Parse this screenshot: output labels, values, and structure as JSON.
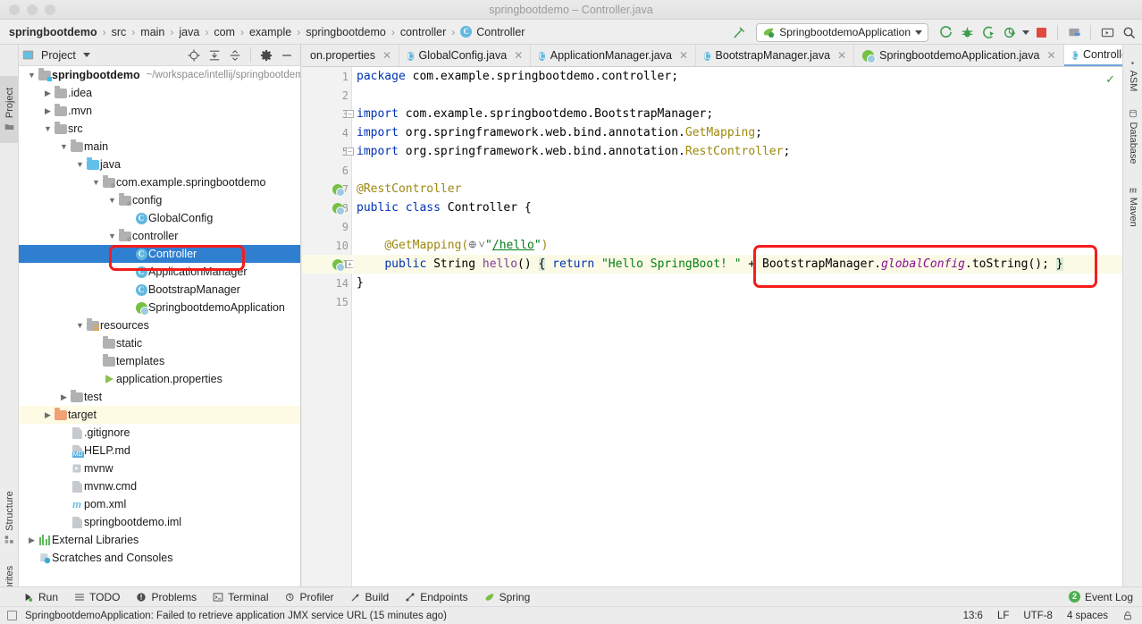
{
  "window": {
    "title": "springbootdemo – Controller.java"
  },
  "breadcrumb": {
    "separator": "›",
    "items": [
      {
        "label": "springbootdemo",
        "bold": true,
        "icon": ""
      },
      {
        "label": "src",
        "bold": false,
        "icon": ""
      },
      {
        "label": "main",
        "bold": false,
        "icon": ""
      },
      {
        "label": "java",
        "bold": false,
        "icon": ""
      },
      {
        "label": "com",
        "bold": false,
        "icon": ""
      },
      {
        "label": "example",
        "bold": false,
        "icon": ""
      },
      {
        "label": "springbootdemo",
        "bold": false,
        "icon": ""
      },
      {
        "label": "controller",
        "bold": false,
        "icon": ""
      },
      {
        "label": "Controller",
        "bold": false,
        "icon": "class-icon"
      }
    ]
  },
  "toolbar": {
    "build_hammer_icon": "hammer-icon",
    "run_configuration": "SpringbootdemoApplication",
    "run_config_icon": "spring-run-icon",
    "dropdown_icon": "chevron-down-icon",
    "run_button_icon": "run-icon",
    "debug_button_icon": "debug-icon",
    "run_with_coverage_icon": "coverage-icon",
    "profiler_icon": "profiler-icon",
    "profiler_dropdown_icon": "chevron-down-icon",
    "stop_button_icon": "stop-icon",
    "updates_icon": "project-structure-icon",
    "tool_icon": "hide-window-icon",
    "search_icon": "search-icon"
  },
  "rail_left": {
    "items": [
      {
        "label": "Project",
        "icon": "project-folder-icon",
        "active": true
      },
      {
        "label": "Structure",
        "icon": "structure-icon",
        "active": false
      },
      {
        "label": "Favorites",
        "icon": "star-icon",
        "active": false
      }
    ]
  },
  "rail_right": {
    "items": [
      {
        "label": "ASM",
        "icon": "asm-icon"
      },
      {
        "label": "Database",
        "icon": "database-icon"
      },
      {
        "label": "Maven",
        "icon": "maven-icon"
      }
    ]
  },
  "project_panel": {
    "title": "Project",
    "title_icon": "project-icon",
    "title_dropdown_icon": "chevron-down-icon",
    "toolbar_icons": [
      "locate-icon",
      "expand-all-icon",
      "collapse-all-icon",
      "settings-gear-icon",
      "hide-icon"
    ],
    "tree": [
      {
        "depth": 0,
        "arrow": "down",
        "icon": "module-folder",
        "label": "springbootdemo",
        "bold": true,
        "sub": "~/workspace/intellij/springbootdemo",
        "state": "normal"
      },
      {
        "depth": 1,
        "arrow": "right",
        "icon": "folder",
        "label": ".idea",
        "bold": false,
        "sub": "",
        "state": "normal"
      },
      {
        "depth": 1,
        "arrow": "right",
        "icon": "folder",
        "label": ".mvn",
        "bold": false,
        "sub": "",
        "state": "normal"
      },
      {
        "depth": 1,
        "arrow": "down",
        "icon": "folder",
        "label": "src",
        "bold": false,
        "sub": "",
        "state": "normal"
      },
      {
        "depth": 2,
        "arrow": "down",
        "icon": "folder",
        "label": "main",
        "bold": false,
        "sub": "",
        "state": "normal"
      },
      {
        "depth": 3,
        "arrow": "down",
        "icon": "source-folder",
        "label": "java",
        "bold": false,
        "sub": "",
        "state": "normal"
      },
      {
        "depth": 4,
        "arrow": "down",
        "icon": "package",
        "label": "com.example.springbootdemo",
        "bold": false,
        "sub": "",
        "state": "normal"
      },
      {
        "depth": 5,
        "arrow": "down",
        "icon": "package",
        "label": "config",
        "bold": false,
        "sub": "",
        "state": "normal"
      },
      {
        "depth": 6,
        "arrow": "none",
        "icon": "class",
        "label": "GlobalConfig",
        "bold": false,
        "sub": "",
        "state": "normal"
      },
      {
        "depth": 5,
        "arrow": "down",
        "icon": "package",
        "label": "controller",
        "bold": false,
        "sub": "",
        "state": "normal"
      },
      {
        "depth": 6,
        "arrow": "none",
        "icon": "class",
        "label": "Controller",
        "bold": false,
        "sub": "",
        "state": "selected"
      },
      {
        "depth": 6,
        "arrow": "none",
        "icon": "class",
        "label": "ApplicationManager",
        "bold": false,
        "sub": "",
        "state": "normal"
      },
      {
        "depth": 6,
        "arrow": "none",
        "icon": "class",
        "label": "BootstrapManager",
        "bold": false,
        "sub": "",
        "state": "normal"
      },
      {
        "depth": 6,
        "arrow": "none",
        "icon": "spring-class",
        "label": "SpringbootdemoApplication",
        "bold": false,
        "sub": "",
        "state": "normal"
      },
      {
        "depth": 3,
        "arrow": "down",
        "icon": "resource-folder",
        "label": "resources",
        "bold": false,
        "sub": "",
        "state": "normal"
      },
      {
        "depth": 4,
        "arrow": "none",
        "icon": "folder",
        "label": "static",
        "bold": false,
        "sub": "",
        "state": "normal"
      },
      {
        "depth": 4,
        "arrow": "none",
        "icon": "folder",
        "label": "templates",
        "bold": false,
        "sub": "",
        "state": "normal"
      },
      {
        "depth": 4,
        "arrow": "none",
        "icon": "spring-properties",
        "label": "application.properties",
        "bold": false,
        "sub": "",
        "state": "normal"
      },
      {
        "depth": 2,
        "arrow": "right",
        "icon": "folder",
        "label": "test",
        "bold": false,
        "sub": "",
        "state": "normal"
      },
      {
        "depth": 1,
        "arrow": "right",
        "icon": "excluded-folder",
        "label": "target",
        "bold": false,
        "sub": "",
        "state": "highlighted"
      },
      {
        "depth": 2,
        "arrow": "none",
        "icon": "gitignore-file",
        "label": ".gitignore",
        "bold": false,
        "sub": "",
        "state": "normal"
      },
      {
        "depth": 2,
        "arrow": "none",
        "icon": "markdown-file",
        "label": "HELP.md",
        "bold": false,
        "sub": "",
        "state": "normal"
      },
      {
        "depth": 2,
        "arrow": "none",
        "icon": "script-file",
        "label": "mvnw",
        "bold": false,
        "sub": "",
        "state": "normal"
      },
      {
        "depth": 2,
        "arrow": "none",
        "icon": "cmd-file",
        "label": "mvnw.cmd",
        "bold": false,
        "sub": "",
        "state": "normal"
      },
      {
        "depth": 2,
        "arrow": "none",
        "icon": "maven-file",
        "label": "pom.xml",
        "bold": false,
        "sub": "",
        "state": "normal"
      },
      {
        "depth": 2,
        "arrow": "none",
        "icon": "iml-file",
        "label": "springbootdemo.iml",
        "bold": false,
        "sub": "",
        "state": "normal"
      },
      {
        "depth": 0,
        "arrow": "right",
        "icon": "libraries",
        "label": "External Libraries",
        "bold": false,
        "sub": "",
        "state": "normal"
      },
      {
        "depth": 0,
        "arrow": "none",
        "icon": "scratches",
        "label": "Scratches and Consoles",
        "bold": false,
        "sub": "",
        "state": "normal"
      }
    ]
  },
  "editor": {
    "tabs": [
      {
        "label": "on.properties",
        "icon": "spring-properties-icon",
        "active": false,
        "truncated": true
      },
      {
        "label": "GlobalConfig.java",
        "icon": "class-icon",
        "active": false
      },
      {
        "label": "ApplicationManager.java",
        "icon": "class-icon",
        "active": false
      },
      {
        "label": "BootstrapManager.java",
        "icon": "class-icon",
        "active": false
      },
      {
        "label": "SpringbootdemoApplication.java",
        "icon": "spring-class-icon",
        "active": false
      },
      {
        "label": "Controller.java",
        "icon": "class-icon",
        "active": true
      }
    ],
    "tab_overflow_icon": "chevron-down-icon",
    "tab_close_icon": "close-icon",
    "inspection_status_icon": "check-icon",
    "line_numbers": [
      "1",
      "2",
      "3",
      "4",
      "5",
      "6",
      "7",
      "8",
      "9",
      "10",
      "11",
      "14",
      "15"
    ],
    "lines": [
      {
        "n": "1",
        "tokens": [
          {
            "t": "package ",
            "c": "kw"
          },
          {
            "t": "com.example.springbootdemo.controller;",
            "c": "plain"
          }
        ]
      },
      {
        "n": "2",
        "tokens": []
      },
      {
        "n": "3",
        "tokens": [
          {
            "t": "import ",
            "c": "kw"
          },
          {
            "t": "com.example.springbootdemo.BootstrapManager;",
            "c": "plain"
          }
        ]
      },
      {
        "n": "4",
        "tokens": [
          {
            "t": "import ",
            "c": "kw"
          },
          {
            "t": "org.springframework.web.bind.annotation.",
            "c": "plain"
          },
          {
            "t": "GetMapping",
            "c": "ann"
          },
          {
            "t": ";",
            "c": "plain"
          }
        ]
      },
      {
        "n": "5",
        "tokens": [
          {
            "t": "import ",
            "c": "kw"
          },
          {
            "t": "org.springframework.web.bind.annotation.",
            "c": "plain"
          },
          {
            "t": "RestController",
            "c": "ann"
          },
          {
            "t": ";",
            "c": "plain"
          }
        ]
      },
      {
        "n": "6",
        "tokens": []
      },
      {
        "n": "7",
        "tokens": [
          {
            "t": "@RestController",
            "c": "ann"
          }
        ]
      },
      {
        "n": "8",
        "tokens": [
          {
            "t": "public ",
            "c": "kw"
          },
          {
            "t": "class ",
            "c": "kw"
          },
          {
            "t": "Controller {",
            "c": "plain"
          }
        ]
      },
      {
        "n": "9",
        "tokens": []
      },
      {
        "n": "10",
        "tokens": [
          {
            "t": "    ",
            "c": "plain"
          },
          {
            "t": "@GetMapping(",
            "c": "ann"
          },
          {
            "t": "@GUTTERICON@",
            "c": "icon"
          },
          {
            "t": "\"",
            "c": "str"
          },
          {
            "t": "/hello",
            "c": "lnk"
          },
          {
            "t": "\"",
            "c": "str"
          },
          {
            "t": ")",
            "c": "ann"
          }
        ]
      },
      {
        "n": "11",
        "tokens": [
          {
            "t": "    ",
            "c": "plain"
          },
          {
            "t": "public ",
            "c": "kw"
          },
          {
            "t": "String ",
            "c": "plain"
          },
          {
            "t": "hello",
            "c": "meth"
          },
          {
            "t": "() ",
            "c": "plain"
          },
          {
            "t": "{",
            "c": "brace"
          },
          {
            "t": " return ",
            "c": "kw"
          },
          {
            "t": "\"Hello SpringBoot! \"",
            "c": "str"
          },
          {
            "t": " + BootstrapManager.",
            "c": "plain"
          },
          {
            "t": "globalConfig",
            "c": "fld"
          },
          {
            "t": ".toString(); ",
            "c": "plain"
          },
          {
            "t": "}",
            "c": "brace"
          }
        ]
      },
      {
        "n": "14",
        "tokens": [
          {
            "t": "}",
            "c": "plain"
          }
        ]
      },
      {
        "n": "15",
        "tokens": []
      }
    ]
  },
  "annotations": {
    "code_box_label": "red-highlight-code",
    "tree_box_label": "red-highlight-tree",
    "color": "#f61c1c"
  },
  "bottom_bar": {
    "items": [
      {
        "label": "Run",
        "icon": "run-icon"
      },
      {
        "label": "TODO",
        "icon": "todo-icon"
      },
      {
        "label": "Problems",
        "icon": "problems-icon"
      },
      {
        "label": "Terminal",
        "icon": "terminal-icon"
      },
      {
        "label": "Profiler",
        "icon": "profiler-icon"
      },
      {
        "label": "Build",
        "icon": "build-hammer-icon"
      },
      {
        "label": "Endpoints",
        "icon": "endpoints-icon"
      },
      {
        "label": "Spring",
        "icon": "spring-leaf-icon"
      }
    ],
    "event_log": {
      "label": "Event Log",
      "count": "2"
    }
  },
  "status_bar": {
    "message": "SpringbootdemoApplication: Failed to retrieve application JMX service URL (15 minutes ago)",
    "caret_position": "13:6",
    "line_separator": "LF",
    "encoding": "UTF-8",
    "indent": "4 spaces",
    "lock_icon": "lock-icon"
  }
}
